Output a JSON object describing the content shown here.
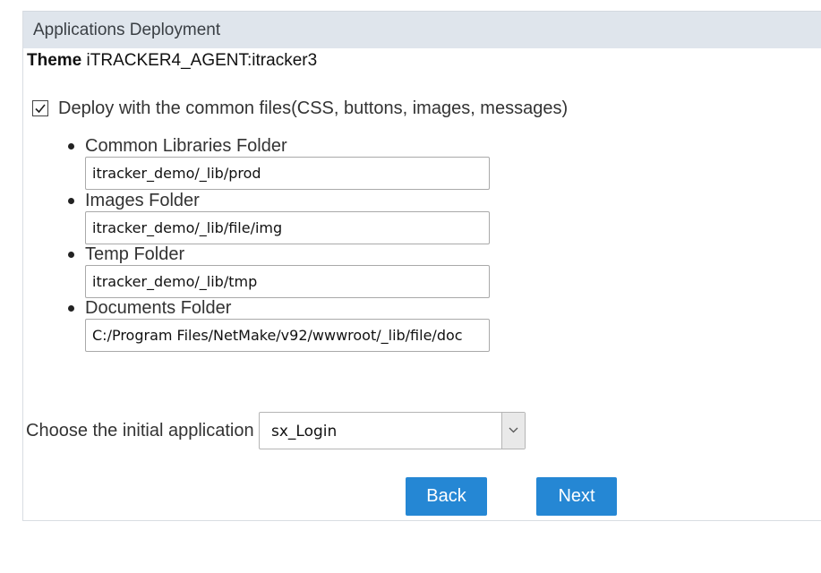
{
  "panel": {
    "title": "Applications Deployment"
  },
  "theme": {
    "label": "Theme",
    "value": "iTRACKER4_AGENT:itracker3"
  },
  "deploy_common": {
    "checked": true,
    "label": "Deploy with the common files(CSS, buttons, images, messages)"
  },
  "folders": [
    {
      "label": "Common Libraries Folder",
      "value": "itracker_demo/_lib/prod"
    },
    {
      "label": "Images Folder",
      "value": "itracker_demo/_lib/file/img"
    },
    {
      "label": "Temp Folder",
      "value": "itracker_demo/_lib/tmp"
    },
    {
      "label": "Documents Folder",
      "value": "C:/Program Files/NetMake/v92/wwwroot/_lib/file/doc"
    }
  ],
  "initial_app": {
    "label": "Choose the initial application",
    "selected": "sx_Login",
    "dropdown_icon": "chevron-down-icon"
  },
  "buttons": {
    "back": "Back",
    "next": "Next"
  },
  "colors": {
    "header_bg": "#dfe5ec",
    "button_bg": "#2587d4",
    "button_text": "#ffffff"
  }
}
